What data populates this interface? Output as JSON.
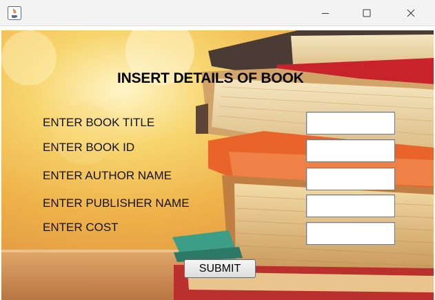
{
  "window": {
    "title": "",
    "app_icon": "java-coffee-cup-icon",
    "controls": {
      "minimize_icon": "minimize-icon",
      "maximize_icon": "maximize-icon",
      "close_icon": "close-icon"
    }
  },
  "form": {
    "heading": "INSERT DETAILS OF BOOK",
    "fields": [
      {
        "label": "ENTER BOOK TITLE",
        "value": ""
      },
      {
        "label": "ENTER BOOK ID",
        "value": ""
      },
      {
        "label": "ENTER AUTHOR NAME",
        "value": ""
      },
      {
        "label": "ENTER PUBLISHER NAME",
        "value": ""
      },
      {
        "label": "ENTER COST",
        "value": ""
      }
    ],
    "submit_label": "SUBMIT"
  },
  "colors": {
    "titlebar": "#f3f3f3",
    "background_warm": "#f2b544",
    "book_orange": "#e8642a",
    "book_red": "#c8232b",
    "book_teal": "#3c9e86",
    "page_cream": "#f1dfb0"
  }
}
